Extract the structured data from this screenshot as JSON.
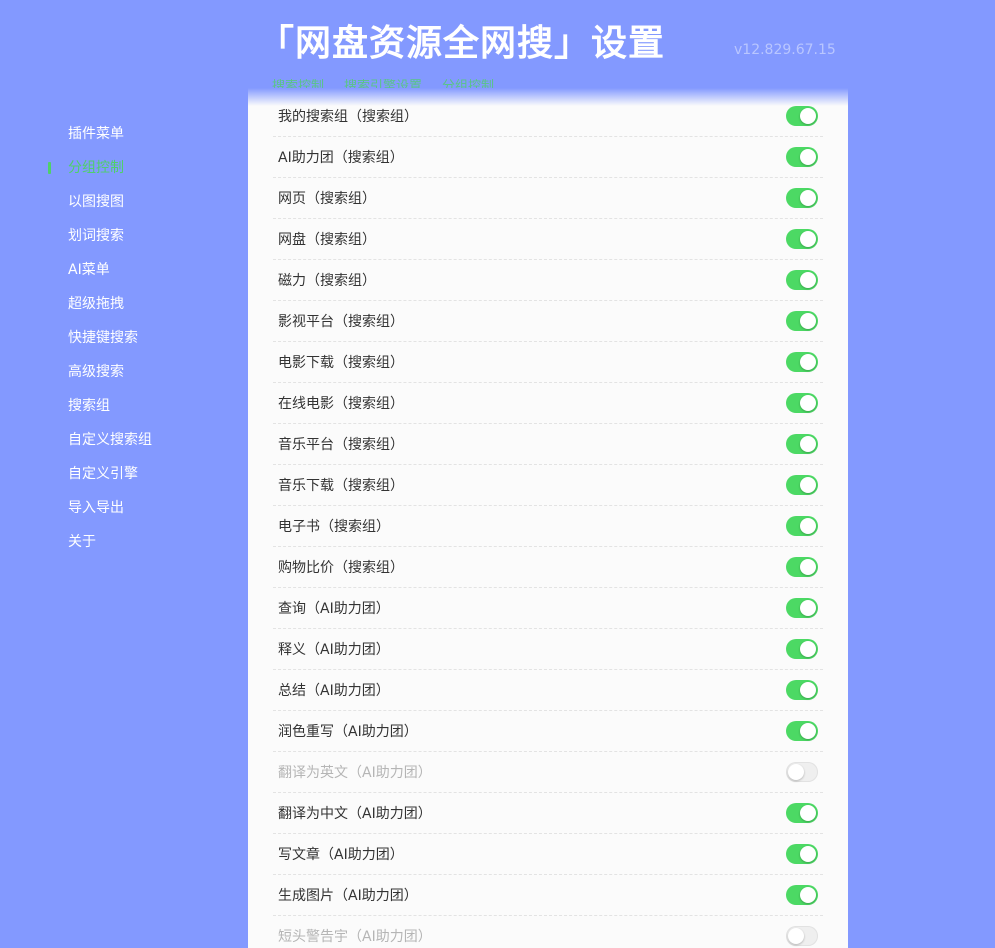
{
  "header": {
    "title": "「网盘资源全网搜」设置",
    "version": "v12.829.67.15",
    "tabs": [
      "搜索控制",
      "搜索引擎设置",
      "分组控制"
    ]
  },
  "sidebar": {
    "items": [
      {
        "label": "插件菜单",
        "active": false
      },
      {
        "label": "分组控制",
        "active": true
      },
      {
        "label": "以图搜图",
        "active": false
      },
      {
        "label": "划词搜索",
        "active": false
      },
      {
        "label": "AI菜单",
        "active": false
      },
      {
        "label": "超级拖拽",
        "active": false
      },
      {
        "label": "快捷键搜索",
        "active": false
      },
      {
        "label": "高级搜索",
        "active": false
      },
      {
        "label": "搜索组",
        "active": false
      },
      {
        "label": "自定义搜索组",
        "active": false
      },
      {
        "label": "自定义引擎",
        "active": false
      },
      {
        "label": "导入导出",
        "active": false
      },
      {
        "label": "关于",
        "active": false
      }
    ]
  },
  "settings": {
    "rows": [
      {
        "label": "我的搜索组（搜索组）",
        "enabled": true
      },
      {
        "label": "AI助力团（搜索组）",
        "enabled": true
      },
      {
        "label": "网页（搜索组）",
        "enabled": true
      },
      {
        "label": "网盘（搜索组）",
        "enabled": true
      },
      {
        "label": "磁力（搜索组）",
        "enabled": true
      },
      {
        "label": "影视平台（搜索组）",
        "enabled": true
      },
      {
        "label": "电影下载（搜索组）",
        "enabled": true
      },
      {
        "label": "在线电影（搜索组）",
        "enabled": true
      },
      {
        "label": "音乐平台（搜索组）",
        "enabled": true
      },
      {
        "label": "音乐下载（搜索组）",
        "enabled": true
      },
      {
        "label": "电子书（搜索组）",
        "enabled": true
      },
      {
        "label": "购物比价（搜索组）",
        "enabled": true
      },
      {
        "label": "查询（AI助力团）",
        "enabled": true
      },
      {
        "label": "释义（AI助力团）",
        "enabled": true
      },
      {
        "label": "总结（AI助力团）",
        "enabled": true
      },
      {
        "label": "润色重写（AI助力团）",
        "enabled": true
      },
      {
        "label": "翻译为英文（AI助力团）",
        "enabled": false
      },
      {
        "label": "翻译为中文（AI助力团）",
        "enabled": true
      },
      {
        "label": "写文章（AI助力团）",
        "enabled": true
      },
      {
        "label": "生成图片（AI助力团）",
        "enabled": true
      },
      {
        "label": "短头警告宇（AI助力团）",
        "enabled": false
      }
    ]
  },
  "colors": {
    "background": "#8399ff",
    "accent": "#4cd964",
    "panel": "#fbfbfb"
  }
}
